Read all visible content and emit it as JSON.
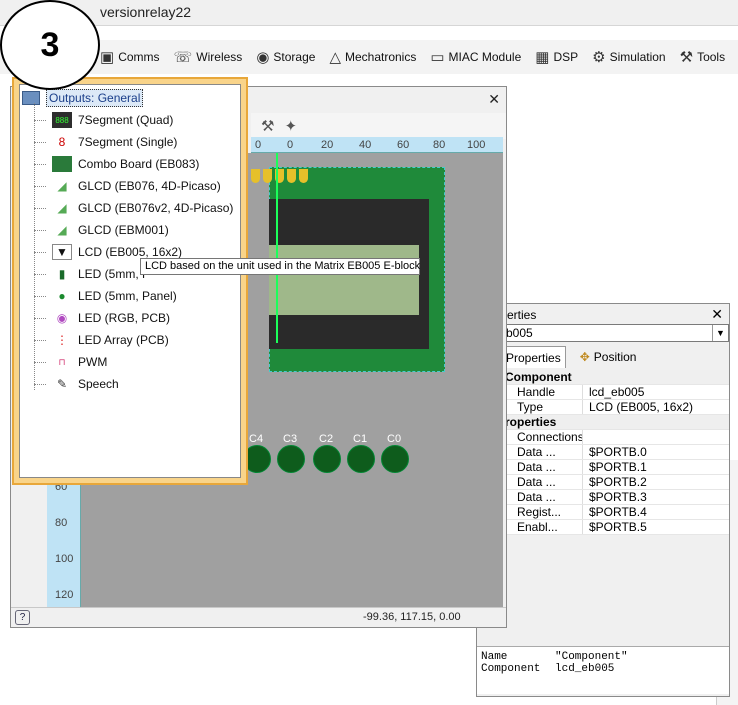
{
  "window": {
    "title_fragment": "versionrelay22"
  },
  "step": {
    "number": "3"
  },
  "toolbar": {
    "items": [
      {
        "label": "Comms",
        "icon": "comms-icon"
      },
      {
        "label": "Wireless",
        "icon": "wireless-icon"
      },
      {
        "label": "Storage",
        "icon": "storage-icon"
      },
      {
        "label": "Mechatronics",
        "icon": "mechatronics-icon"
      },
      {
        "label": "MIAC Module",
        "icon": "miac-icon"
      },
      {
        "label": "DSP",
        "icon": "dsp-icon"
      },
      {
        "label": "Simulation",
        "icon": "simulation-icon"
      },
      {
        "label": "Tools",
        "icon": "tools-icon"
      }
    ]
  },
  "menu": {
    "header": "Outputs: General",
    "items": [
      {
        "label": "7Segment (Quad)",
        "icon": "7segment-quad-icon"
      },
      {
        "label": "7Segment (Single)",
        "icon": "7segment-single-icon"
      },
      {
        "label": "Combo Board (EB083)",
        "icon": "combo-board-icon"
      },
      {
        "label": "GLCD (EB076, 4D-Picaso)",
        "icon": "glcd-icon"
      },
      {
        "label": "GLCD (EB076v2, 4D-Picaso)",
        "icon": "glcd-icon"
      },
      {
        "label": "GLCD (EBM001)",
        "icon": "glcd-icon"
      },
      {
        "label": "LCD (EB005, 16x2)",
        "icon": "lcd-dropdown-icon"
      },
      {
        "label": "LED (5mm, P",
        "icon": "led-icon"
      },
      {
        "label": "LED (5mm, Panel)",
        "icon": "led-panel-icon"
      },
      {
        "label": "LED (RGB, PCB)",
        "icon": "led-rgb-icon"
      },
      {
        "label": "LED Array (PCB)",
        "icon": "led-array-icon"
      },
      {
        "label": "PWM",
        "icon": "pwm-icon"
      },
      {
        "label": "Speech",
        "icon": "speech-icon"
      }
    ],
    "tooltip": "LCD based on the unit used in the Matrix EB005 E-block"
  },
  "panel": {
    "ruler_top": [
      "0",
      "0",
      "20",
      "40",
      "60",
      "80",
      "100"
    ],
    "ruler_left": [
      "60",
      "80",
      "100",
      "120"
    ],
    "led_labels": [
      "C4",
      "C3",
      "C2",
      "C1",
      "C0"
    ],
    "coords": "-99.36, 117.15, 0.00"
  },
  "properties": {
    "title": "erties",
    "selected": "b005",
    "tabs": [
      "Properties",
      "Position"
    ],
    "rows": [
      {
        "type": "section",
        "key": "Component",
        "value": ""
      },
      {
        "type": "row",
        "key": "Handle",
        "value": "lcd_eb005"
      },
      {
        "type": "row",
        "key": "Type",
        "value": "LCD (EB005, 16x2)"
      },
      {
        "type": "section",
        "key": "roperties",
        "value": ""
      },
      {
        "type": "row",
        "key": "Connections",
        "value": ""
      },
      {
        "type": "row",
        "key": "Data ...",
        "value": "$PORTB.0"
      },
      {
        "type": "row",
        "key": "Data ...",
        "value": "$PORTB.1"
      },
      {
        "type": "row",
        "key": "Data ...",
        "value": "$PORTB.2"
      },
      {
        "type": "row",
        "key": "Data ...",
        "value": "$PORTB.3"
      },
      {
        "type": "row",
        "key": "Regist...",
        "value": "$PORTB.4"
      },
      {
        "type": "row",
        "key": "Enabl...",
        "value": "$PORTB.5"
      }
    ],
    "bottom": [
      {
        "k": "Name",
        "v": "\"Component\""
      },
      {
        "k": "Component",
        "v": "lcd_eb005"
      }
    ]
  }
}
